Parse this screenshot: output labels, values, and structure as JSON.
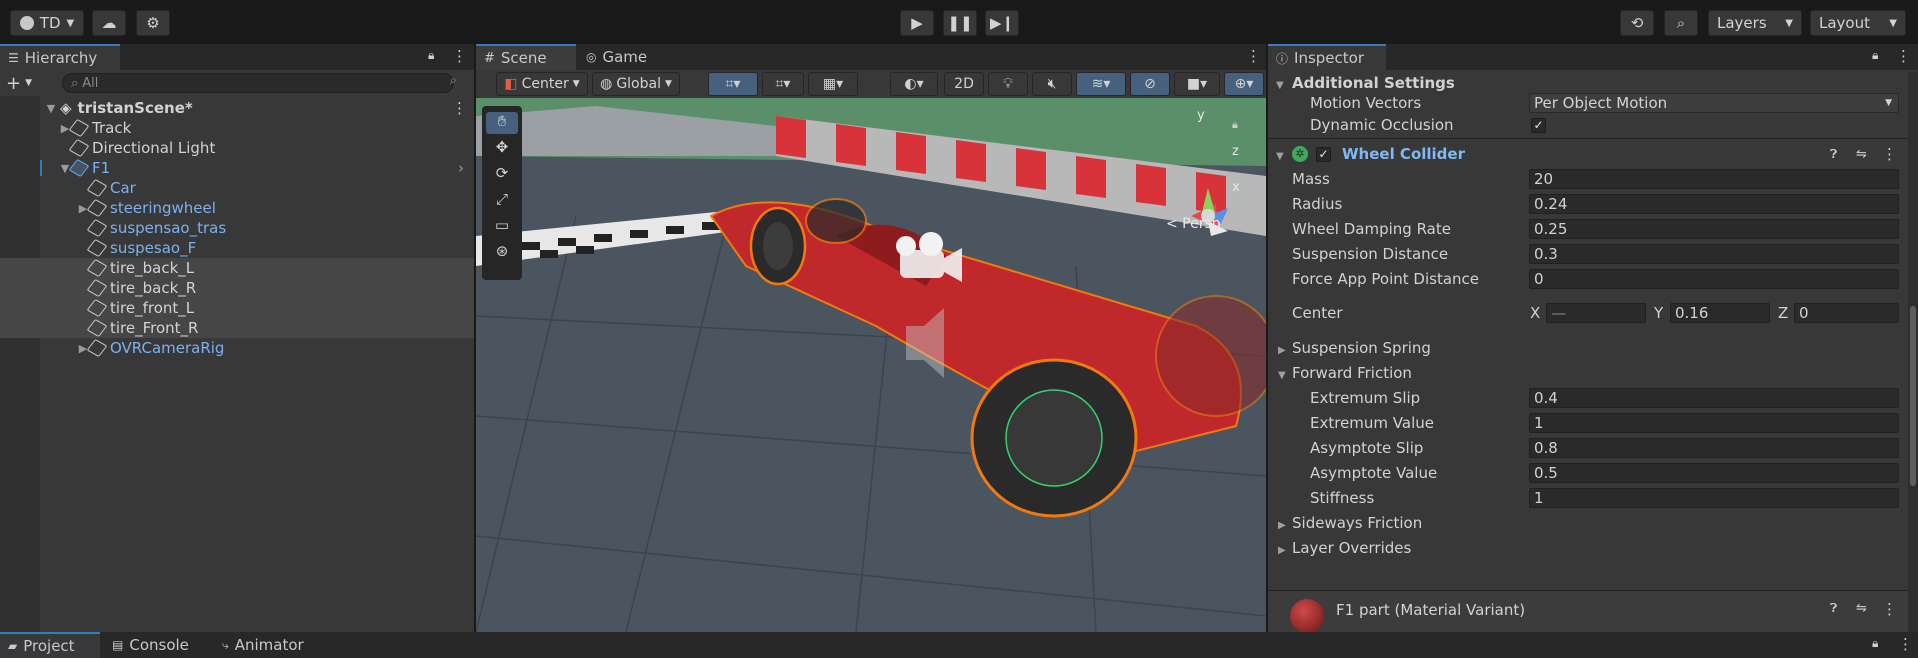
{
  "toolbar": {
    "account_label": "TD",
    "layers_label": "Layers",
    "layout_label": "Layout"
  },
  "hierarchy": {
    "tab_label": "Hierarchy",
    "search_placeholder": "All",
    "scene_name": "tristanScene*",
    "items": [
      {
        "label": "Track"
      },
      {
        "label": "Directional Light"
      },
      {
        "label": "F1"
      },
      {
        "label": "Car"
      },
      {
        "label": "steeringwheel"
      },
      {
        "label": "suspensao_tras"
      },
      {
        "label": "suspesao_F"
      },
      {
        "label": "tire_back_L"
      },
      {
        "label": "tire_back_R"
      },
      {
        "label": "tire_front_L"
      },
      {
        "label": "tire_Front_R"
      },
      {
        "label": "OVRCameraRig"
      }
    ]
  },
  "scene": {
    "tab_scene": "Scene",
    "tab_game": "Game",
    "pivot_label": "Center",
    "space_label": "Global",
    "mode_2d": "2D",
    "persp_label": "< Persp",
    "gizmo_y": "y",
    "gizmo_z": "z",
    "gizmo_x": "x"
  },
  "inspector": {
    "tab_label": "Inspector",
    "additional_settings": "Additional Settings",
    "motion_vectors_label": "Motion Vectors",
    "motion_vectors_value": "Per Object Motion",
    "dynamic_occlusion_label": "Dynamic Occlusion",
    "component_title": "Wheel Collider",
    "fields": [
      {
        "label": "Mass",
        "value": "20"
      },
      {
        "label": "Radius",
        "value": "0.24"
      },
      {
        "label": "Wheel Damping Rate",
        "value": "0.25"
      },
      {
        "label": "Suspension Distance",
        "value": "0.3"
      },
      {
        "label": "Force App Point Distance",
        "value": "0"
      }
    ],
    "center": {
      "label": "Center",
      "x_label": "X",
      "x_value": "—",
      "y_label": "Y",
      "y_value": "0.16",
      "z_label": "Z",
      "z_value": "0"
    },
    "suspension_spring": "Suspension Spring",
    "forward_friction": "Forward Friction",
    "friction_fields": [
      {
        "label": "Extremum Slip",
        "value": "0.4"
      },
      {
        "label": "Extremum Value",
        "value": "1"
      },
      {
        "label": "Asymptote Slip",
        "value": "0.8"
      },
      {
        "label": "Asymptote Value",
        "value": "0.5"
      },
      {
        "label": "Stiffness",
        "value": "1"
      }
    ],
    "sideways_friction": "Sideways Friction",
    "layer_overrides": "Layer Overrides",
    "material_label": "F1 part (Material Variant)"
  },
  "bottom_tabs": [
    {
      "label": "Project"
    },
    {
      "label": "Console"
    },
    {
      "label": "Animator"
    }
  ],
  "colors": {
    "accent": "#3a79bb",
    "prefab_text": "#7cb0f0",
    "selection_orange": "#f07a10"
  }
}
